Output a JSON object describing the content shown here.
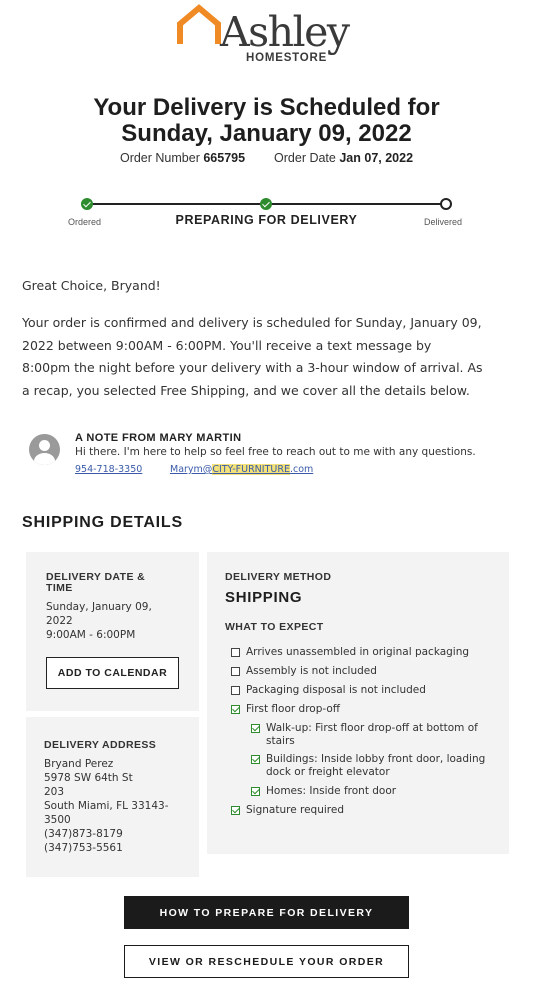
{
  "brand": {
    "name": "Ashley",
    "sub": "HOMESTORE",
    "accent_color": "#f08a24",
    "logo_icon": "house-roof-icon"
  },
  "headline": {
    "line1": "Your Delivery is Scheduled for",
    "line2": "Sunday, January 09, 2022"
  },
  "order": {
    "number_label": "Order Number",
    "number": "665795",
    "date_label": "Order Date",
    "date": "Jan 07, 2022"
  },
  "tracker": {
    "steps": [
      {
        "label": "Ordered",
        "status": "complete"
      },
      {
        "label": "PREPARING FOR DELIVERY",
        "status": "complete"
      },
      {
        "label": "Delivered",
        "status": "pending"
      }
    ],
    "check_color": "#2e8b2e"
  },
  "message": {
    "greeting": "Great Choice, Bryand!",
    "lines": [
      "Your order is confirmed and delivery is scheduled for Sunday, January 09,",
      "2022 between 9:00AM - 6:00PM. You'll receive a text message by",
      "8:00pm the night before your delivery with a 3-hour window of arrival. As",
      "a recap, you selected Free Shipping, and we cover all the details below."
    ]
  },
  "note": {
    "title": "A NOTE FROM MARY MARTIN",
    "text": "Hi there. I'm here to help so feel free to reach out to me with any questions.",
    "phone": "954-718-3350",
    "email_prefix": "Marym@",
    "email_highlight": "CITY-FURNITURE",
    "email_suffix": ".com",
    "avatar_icon": "user-avatar-icon"
  },
  "shipping": {
    "section_title": "SHIPPING DETAILS",
    "date_time": {
      "label_line1": "DELIVERY DATE &",
      "label_line2": "TIME",
      "date_line1": "Sunday, January 09,",
      "date_line2": "2022",
      "window": "9:00AM - 6:00PM",
      "button": "ADD TO CALENDAR"
    },
    "address": {
      "label": "DELIVERY ADDRESS",
      "lines": [
        "Bryand Perez",
        "5978 SW 64th St",
        "203",
        "South Miami, FL 33143-",
        "3500",
        "(347)873-8179",
        "(347)753-5561"
      ]
    },
    "method": {
      "label": "DELIVERY METHOD",
      "name": "SHIPPING",
      "expect_label": "WHAT TO EXPECT",
      "items": [
        {
          "lines": [
            "Arrives unassembled in original packaging"
          ],
          "checked": false
        },
        {
          "lines": [
            "Assembly is not included"
          ],
          "checked": false
        },
        {
          "lines": [
            "Packaging disposal is not included"
          ],
          "checked": false
        },
        {
          "lines": [
            "First floor drop-off"
          ],
          "checked": true
        },
        {
          "lines": [
            "Walk-up: First floor drop-off at bottom of",
            "stairs"
          ],
          "checked": true
        },
        {
          "lines": [
            "Buildings: Inside lobby front door, loading",
            "dock or freight elevator"
          ],
          "checked": true
        },
        {
          "lines": [
            "Homes: Inside front door"
          ],
          "checked": true
        },
        {
          "lines": [
            "Signature required"
          ],
          "checked": true
        }
      ]
    }
  },
  "buttons": {
    "prepare": "HOW TO PREPARE FOR DELIVERY",
    "reschedule": "VIEW OR RESCHEDULE YOUR ORDER"
  }
}
